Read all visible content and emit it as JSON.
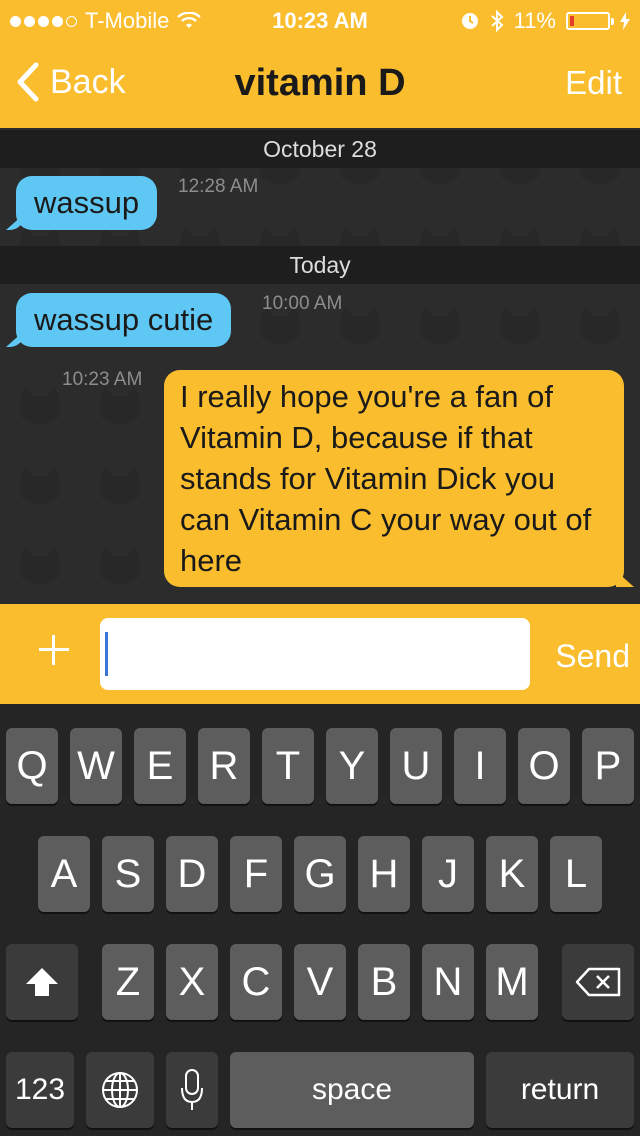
{
  "status_bar": {
    "carrier": "T-Mobile",
    "time": "10:23 AM",
    "battery": "11%"
  },
  "nav": {
    "back_label": "Back",
    "title": "vitamin D",
    "edit_label": "Edit"
  },
  "conversation": {
    "sections": [
      {
        "date": "October 28",
        "messages": [
          {
            "direction": "incoming",
            "text": "wassup",
            "time": "12:28 AM"
          }
        ]
      },
      {
        "date": "Today",
        "messages": [
          {
            "direction": "incoming",
            "text": "wassup cutie",
            "time": "10:00 AM"
          },
          {
            "direction": "outgoing",
            "text": "I really hope you're a fan of Vitamin D, because if that stands for Vitamin Dick you can Vitamin C your way out of here",
            "time": "10:23 AM"
          }
        ]
      }
    ]
  },
  "composer": {
    "value": "",
    "send_label": "Send"
  },
  "keyboard": {
    "row1": [
      "Q",
      "W",
      "E",
      "R",
      "T",
      "Y",
      "U",
      "I",
      "O",
      "P"
    ],
    "row2": [
      "A",
      "S",
      "D",
      "F",
      "G",
      "H",
      "J",
      "K",
      "L"
    ],
    "row3": [
      "Z",
      "X",
      "C",
      "V",
      "B",
      "N",
      "M"
    ],
    "numbers_label": "123",
    "space_label": "space",
    "return_label": "return"
  },
  "colors": {
    "brand_yellow": "#f9bd2e",
    "incoming_bubble": "#5fc7f3",
    "battery_low": "#e53d2b"
  }
}
